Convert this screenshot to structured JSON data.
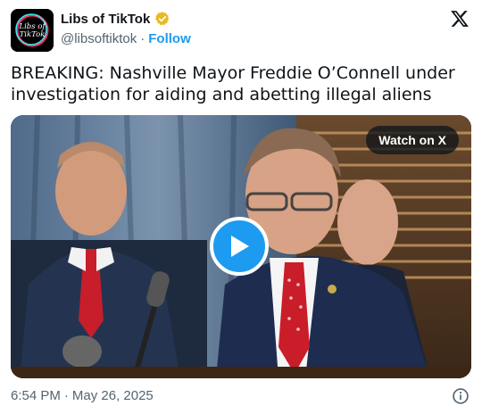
{
  "author": {
    "display_name": "Libs of TikTok",
    "handle": "@libsoftiktok",
    "separator": "·",
    "follow_label": "Follow",
    "avatar_text_line1": "Libs of",
    "avatar_text_line2": "TikTok",
    "verified_color": "#e8b923"
  },
  "tweet": {
    "text": "BREAKING: Nashville Mayor Freddie O’Connell under investigation for aiding and abetting illegal aliens"
  },
  "media": {
    "watch_label": "Watch on X",
    "play_icon": "play-icon",
    "accent": "#1d9bf0"
  },
  "footer": {
    "time": "6:54 PM",
    "separator": "·",
    "date": "May 26, 2025",
    "info_icon": "info-icon"
  },
  "colors": {
    "text_primary": "#0f1419",
    "text_secondary": "#536471",
    "link": "#1d9bf0"
  }
}
